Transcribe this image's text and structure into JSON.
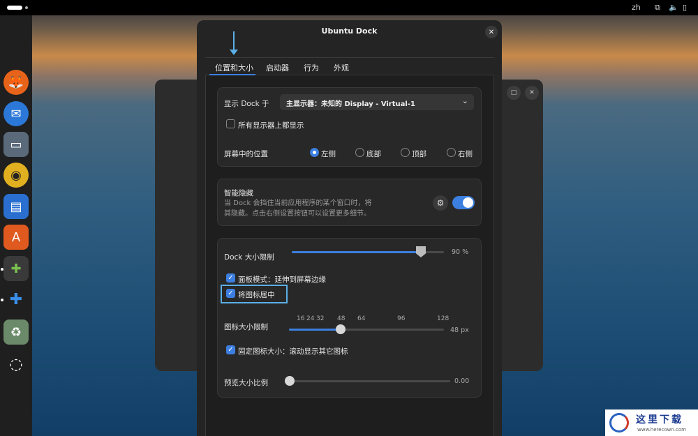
{
  "topbar": {
    "lang": "zh",
    "icons": [
      "network-icon",
      "volume-icon",
      "battery-icon"
    ]
  },
  "dock": {
    "apps": [
      {
        "name": "firefox-icon",
        "glyph": "🦊"
      },
      {
        "name": "thunderbird-icon",
        "glyph": "✉"
      },
      {
        "name": "files-icon",
        "glyph": "▭"
      },
      {
        "name": "rhythmbox-icon",
        "glyph": "◉"
      },
      {
        "name": "writer-icon",
        "glyph": "▤"
      },
      {
        "name": "app-center-icon",
        "glyph": "A"
      },
      {
        "name": "extension-manager-icon",
        "glyph": "✚"
      },
      {
        "name": "extensions-icon",
        "glyph": "✚"
      },
      {
        "name": "trash-icon",
        "glyph": "♻"
      },
      {
        "name": "ubuntu-icon",
        "glyph": "◌"
      }
    ]
  },
  "dialog": {
    "title": "Ubuntu Dock",
    "close_glyph": "✕",
    "tabs": [
      "位置和大小",
      "启动器",
      "行为",
      "外观"
    ],
    "display_label": "显示 Dock 于",
    "display_value": "主显示器：未知的 Display - Virtual-1",
    "combo_arrow": "⌄",
    "all_displays_label": "所有显示器上都显示",
    "position_label": "屏幕中的位置",
    "positions": [
      "左侧",
      "底部",
      "顶部",
      "右侧"
    ],
    "selected_position": "左侧",
    "autohide_title": "智能隐藏",
    "autohide_desc_1": "当 Dock 会挡住当前应用程序的某个窗口时，将",
    "autohide_desc_2": "其隐藏。点击右侧设置按钮可以设置更多细节。",
    "autohide_on": true,
    "gear_glyph": "⚙",
    "dock_size_label": "Dock 大小限制",
    "dock_size_value": "90 %",
    "dock_size_fraction": 0.9,
    "panel_mode_label": "面板模式：延伸到屏幕边缘",
    "center_icons_label": "将图标居中",
    "icon_size_label": "图标大小限制",
    "icon_ticks": [
      "16",
      "24",
      "32",
      "48",
      "64",
      "96",
      "128"
    ],
    "icon_size_value": "48 px",
    "fixed_icon_label": "固定图标大小：滚动显示其它图标",
    "preview_label": "预览大小比例",
    "preview_value": "0.00",
    "check_glyph": "✓"
  },
  "back_window": {
    "max_glyph": "□",
    "close_glyph": "✕"
  },
  "watermark": {
    "text": "这里下载",
    "url": "www.herecown.com"
  },
  "colors": {
    "accent": "#3c7fe0",
    "highlight": "#5ab0e8"
  }
}
